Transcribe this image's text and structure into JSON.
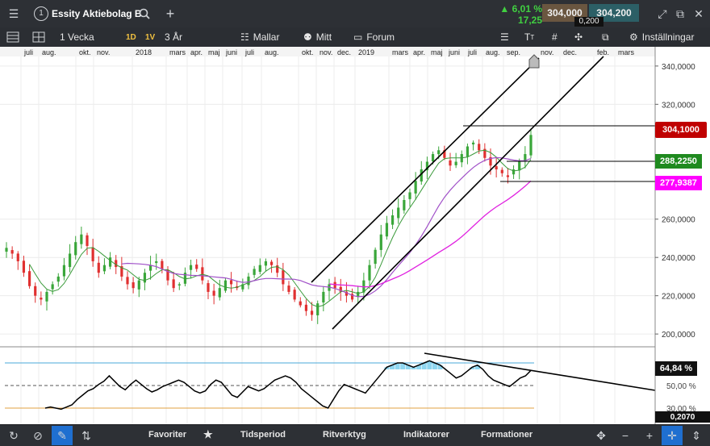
{
  "header": {
    "instrument_title": "Essity Aktiebolag B",
    "change_percent": "6,01 %",
    "change_abs": "17,25",
    "bid": "304,000",
    "ask": "304,200",
    "spread": "0,200",
    "menu_number": "1"
  },
  "toolbar": {
    "interval": "1 Vecka",
    "range_1d": "1D",
    "range_1v": "1V",
    "period": "3 År",
    "templates": "Mallar",
    "mine": "Mitt",
    "forum": "Forum",
    "settings": "Inställningar",
    "text_tool": "T"
  },
  "time_axis": {
    "labels": [
      "juli",
      "aug.",
      "okt.",
      "nov.",
      "2018",
      "mars",
      "apr.",
      "maj",
      "juni",
      "juli",
      "aug.",
      "okt.",
      "nov.",
      "dec.",
      "2019",
      "mars",
      "apr.",
      "maj",
      "juni",
      "juli",
      "aug.",
      "sep.",
      "nov.",
      "dec.",
      "feb.",
      "mars"
    ]
  },
  "price_axis": {
    "labels": [
      "340,0000",
      "320,0000",
      "304,1000",
      "288,2250",
      "277,9387",
      "260,0000",
      "240,0000",
      "220,0000",
      "200,0000"
    ],
    "last_price": "304,1000",
    "green_level": "288,2250",
    "magenta_level": "277,9387"
  },
  "indicator_axis": {
    "current": "64,84 %",
    "mid": "50,00 %",
    "low": "30,00 %",
    "cursor": "0,2070"
  },
  "bottom": {
    "favorites": "Favoriter",
    "time_period": "Tidsperiod",
    "drawing_tools": "Ritverktyg",
    "indicators": "Indikatorer",
    "formations": "Formationer"
  },
  "colors": {
    "up": "#3aa63a",
    "down": "#e03030",
    "ma_short": "#3a9a3a",
    "ma_mid": "#a050c8",
    "ma_long": "#e020e0",
    "last_price_box": "#c00000",
    "green_box": "#1f8a1f",
    "magenta_box": "#ff00ff"
  },
  "chart_data": {
    "type": "candlestick",
    "ylim": [
      195,
      345
    ],
    "note_series": [
      {
        "name": "MA short"
      },
      {
        "name": "MA mid"
      },
      {
        "name": "MA long"
      }
    ],
    "close_series": [
      245,
      242,
      238,
      232,
      225,
      220,
      218,
      222,
      226,
      230,
      236,
      242,
      248,
      252,
      246,
      238,
      232,
      236,
      240,
      235,
      230,
      226,
      224,
      228,
      232,
      236,
      238,
      234,
      228,
      224,
      226,
      232,
      236,
      234,
      228,
      222,
      220,
      224,
      228,
      226,
      224,
      226,
      230,
      234,
      236,
      238,
      236,
      232,
      226,
      222,
      218,
      215,
      212,
      210,
      216,
      222,
      226,
      224,
      222,
      220,
      218,
      222,
      228,
      236,
      244,
      252,
      258,
      262,
      266,
      270,
      274,
      280,
      286,
      290,
      294,
      296,
      292,
      288,
      290,
      294,
      298,
      300,
      296,
      292,
      288,
      286,
      284,
      282,
      286,
      290,
      294,
      304
    ],
    "rsi_series": [
      30,
      31,
      30,
      29,
      31,
      33,
      38,
      42,
      46,
      48,
      52,
      55,
      60,
      55,
      50,
      47,
      52,
      56,
      52,
      48,
      45,
      47,
      50,
      52,
      54,
      56,
      54,
      50,
      46,
      44,
      46,
      52,
      56,
      54,
      48,
      42,
      40,
      45,
      50,
      48,
      46,
      48,
      52,
      56,
      58,
      60,
      58,
      54,
      48,
      44,
      40,
      36,
      32,
      30,
      38,
      46,
      52,
      50,
      48,
      46,
      44,
      50,
      56,
      62,
      68,
      70,
      72,
      72,
      70,
      68,
      70,
      72,
      74,
      72,
      70,
      66,
      62,
      58,
      60,
      64,
      68,
      70,
      66,
      60,
      56,
      54,
      52,
      50,
      54,
      58,
      60,
      65
    ]
  }
}
